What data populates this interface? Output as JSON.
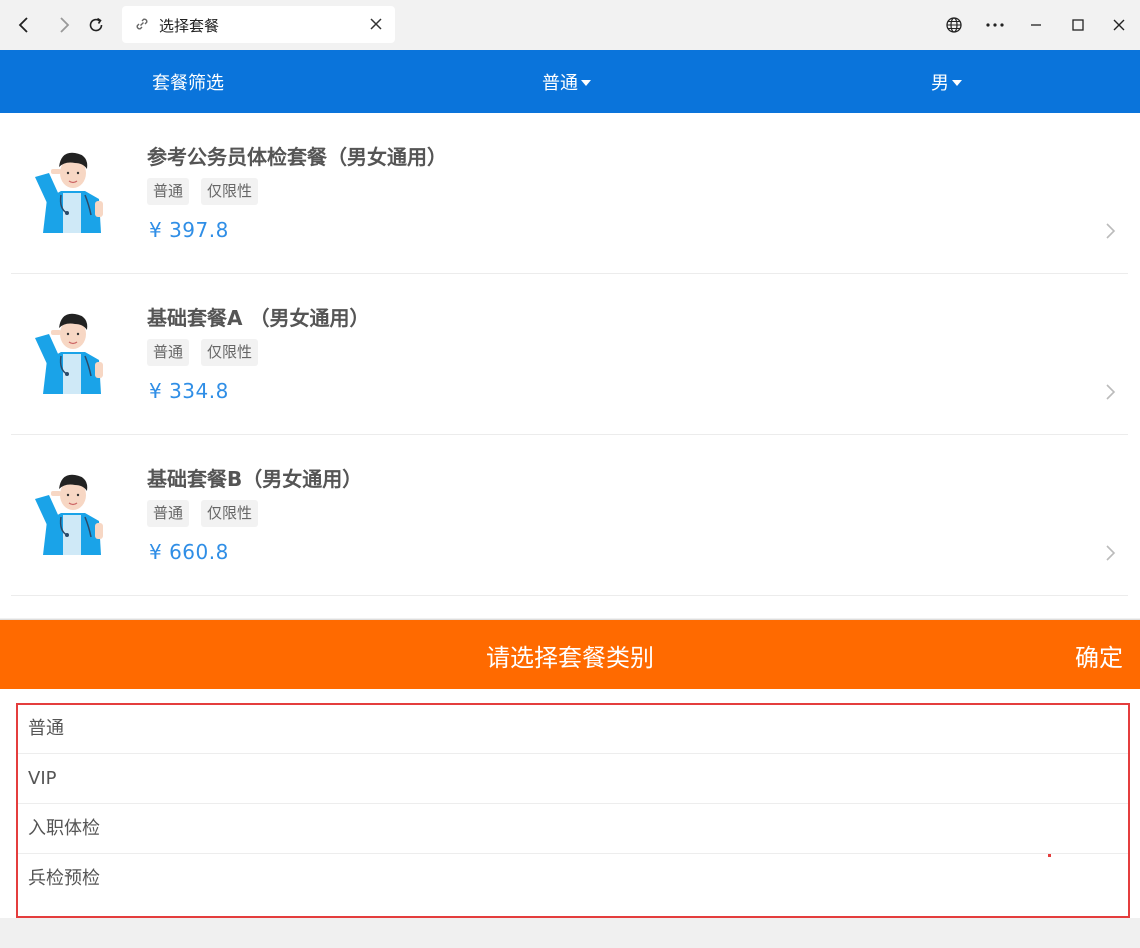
{
  "browser": {
    "tab_title": "选择套餐"
  },
  "header": {
    "filter_label": "套餐筛选",
    "category_selected": "普通",
    "gender_selected": "男",
    "color": "#0a74db"
  },
  "packages": [
    {
      "title": "参考公务员体检套餐（男女通用）",
      "tags": [
        "普通",
        "仅限性"
      ],
      "price": "¥ 397.8"
    },
    {
      "title": "基础套餐A （男女通用）",
      "tags": [
        "普通",
        "仅限性"
      ],
      "price": "¥ 334.8"
    },
    {
      "title": "基础套餐B（男女通用）",
      "tags": [
        "普通",
        "仅限性"
      ],
      "price": "¥ 660.8"
    }
  ],
  "picker": {
    "title": "请选择套餐类别",
    "confirm_label": "确定",
    "options": [
      "普通",
      "VIP",
      "入职体检",
      "兵检预检"
    ],
    "accent": "#ff6a00"
  }
}
